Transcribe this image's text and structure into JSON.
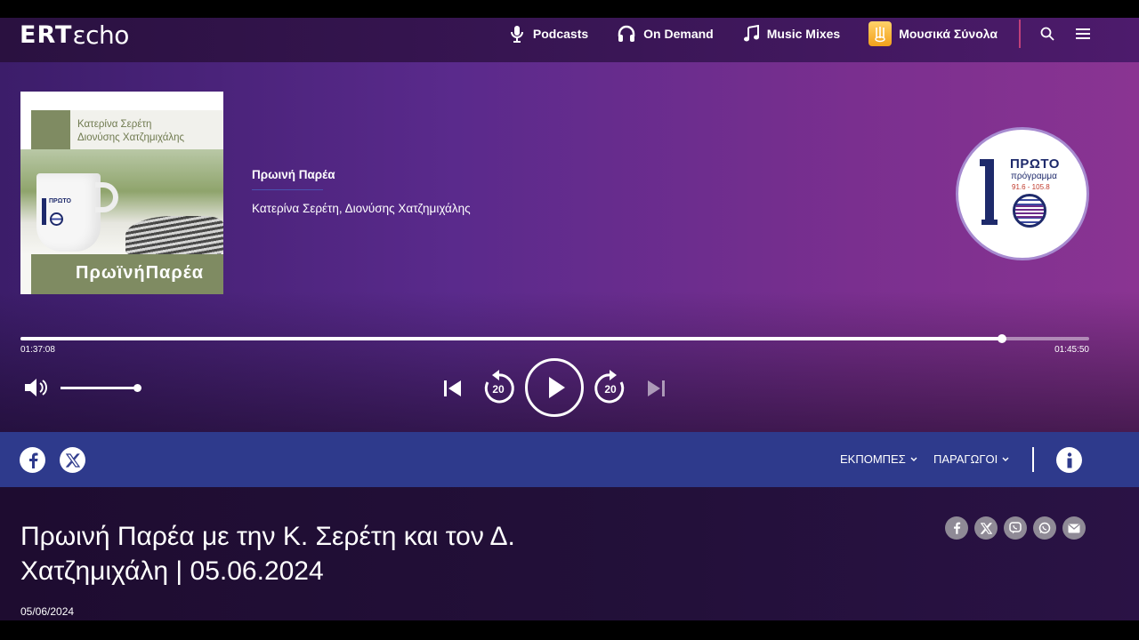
{
  "header": {
    "logo_ert": "ERT",
    "logo_echo": "εcho",
    "nav": [
      {
        "label": "Podcasts",
        "icon": "podcast-mic-icon"
      },
      {
        "label": "On Demand",
        "icon": "headphones-icon"
      },
      {
        "label": "Music Mixes",
        "icon": "music-note-icon"
      },
      {
        "label": "Μουσικά Σύνολα",
        "icon": "ensembles-icon"
      }
    ],
    "icons": [
      "search-icon",
      "menu-icon"
    ]
  },
  "player": {
    "cover": {
      "host_line_1": "Κατερίνα Σερέτη",
      "host_line_2": "Διονύσης Χατζημιχάλης",
      "title": "ΠρωϊνήΠαρέα",
      "cup_logo_text": "ΠΡΩΤΟ"
    },
    "show_title": "Πρωινή Παρέα",
    "show_hosts": "Κατερίνα Σερέτη, Διονύσης Χατζημιχάλης",
    "station": {
      "name": "ΠΡΩΤΟ",
      "subtitle": "πρόγραμμα",
      "frequency": "91.6 - 105.8"
    },
    "elapsed": "01:37:08",
    "duration": "01:45:50",
    "progress_fraction": 0.918,
    "volume_fraction": 1.0,
    "rewind_seconds": "20",
    "forward_seconds": "20"
  },
  "subbar": {
    "social": [
      "facebook-icon",
      "x-icon"
    ],
    "menu_shows": "ΕΚΠΟΜΠΕΣ",
    "menu_producers": "ΠΑΡΑΓΩΓΟΙ"
  },
  "episode": {
    "title": "Πρωινή Παρέα με την Κ. Σερέτη και τον Δ. Χατζημιχάλη | 05.06.2024",
    "date": "05/06/2024",
    "share": [
      "facebook-icon",
      "x-icon",
      "viber-icon",
      "whatsapp-icon",
      "email-icon"
    ]
  },
  "colors": {
    "accent_pink": "#c0407a",
    "subbar_blue": "#2e3a8c",
    "cover_green": "#7f8b62"
  }
}
